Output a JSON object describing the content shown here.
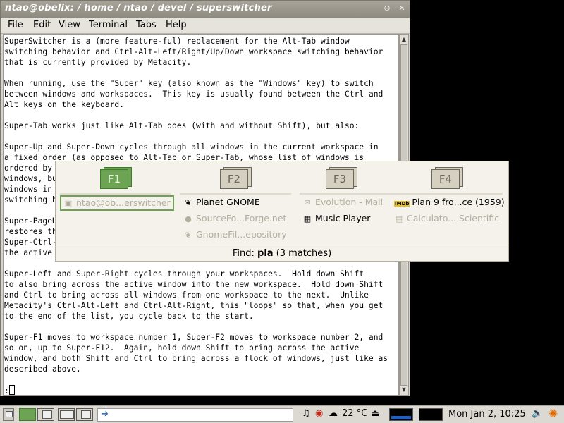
{
  "window": {
    "title": "ntao@obelix: / home / ntao / devel / superswitcher",
    "minimize_glyph": "⊙",
    "close_glyph": "✕"
  },
  "menu": [
    "File",
    "Edit",
    "View",
    "Terminal",
    "Tabs",
    "Help"
  ],
  "terminal_lines_top": [
    "SuperSwitcher is a (more feature-ful) replacement for the Alt-Tab window",
    "switching behavior and Ctrl-Alt-Left/Right/Up/Down workspace switching behavior",
    "that is currently provided by Metacity.",
    "",
    "When running, use the \"Super\" key (also known as the \"Windows\" key) to switch",
    "between windows and workspaces.  This key is usually found between the Ctrl and",
    "Alt keys on the keyboard.",
    "",
    "Super-Tab works just like Alt-Tab does (with and without Shift), but also:",
    "",
    "Super-Up and Super-Down cycles through all windows in the current workspace in",
    "a fixed order (as opposed to Alt-Tab or Super-Tab, whose list of windows is",
    "ordered by",
    "windows, bu",
    "windows in",
    "switching b",
    "",
    "Super-PageU",
    "restores th",
    "Super-Ctrl-",
    "the active",
    "",
    "Super-Left and Super-Right cycles through your workspaces.  Hold down Shift",
    "to also bring across the active window into the new workspace.  Hold down Shift",
    "and Ctrl to bring across all windows from one workspace to the next.  Unlike",
    "Metacity's Ctrl-Alt-Left and Ctrl-Alt-Right, this \"loops\" so that, when you get",
    "to the end of the list, you cycle back to the start.",
    "",
    "Super-F1 moves to workspace number 1, Super-F2 moves to workspace number 2, and",
    "so on, up to Super-F12.  Again, hold down Shift to bring across the active",
    "window, and both Shift and Ctrl to bring across a flock of windows, just like as",
    "described above.",
    "",
    ":"
  ],
  "switcher": {
    "workspaces": [
      {
        "label": "F1",
        "active": true
      },
      {
        "label": "F2",
        "active": false
      },
      {
        "label": "F3",
        "active": false
      },
      {
        "label": "F4",
        "active": false
      }
    ],
    "ws1_items": [
      {
        "label": "ntao@ob...erswitcher",
        "icon": "terminal-icon",
        "glyph": "▣",
        "state": "selected"
      }
    ],
    "ws2_items": [
      {
        "label": "Planet GNOME",
        "icon": "gnome-foot-icon",
        "glyph": "❦",
        "state": "match"
      },
      {
        "label": "SourceFo...Forge.net",
        "icon": "globe-icon",
        "glyph": "●",
        "state": "dim"
      },
      {
        "label": "GnomeFil...epository",
        "icon": "gnome-foot-icon",
        "glyph": "❦",
        "state": "dim"
      }
    ],
    "ws3_items": [
      {
        "label": "Evolution - Mail",
        "icon": "mail-icon",
        "glyph": "✉",
        "state": "dim"
      },
      {
        "label": "Music Player",
        "icon": "music-player-icon",
        "glyph": "▦",
        "state": "match"
      }
    ],
    "ws4_items": [
      {
        "label": "Plan 9 fro...ce (1959)",
        "icon": "imdb-icon",
        "glyph": "IMDb",
        "state": "match"
      },
      {
        "label": "Calculato... Scientific",
        "icon": "calculator-icon",
        "glyph": "▤",
        "state": "dim"
      }
    ],
    "find_label": "Find:",
    "find_query": "pla",
    "find_count": "(3 matches)",
    "accent": "#6da453"
  },
  "panel": {
    "temperature": "22 °C",
    "clock": "Mon Jan  2, 10:25"
  }
}
